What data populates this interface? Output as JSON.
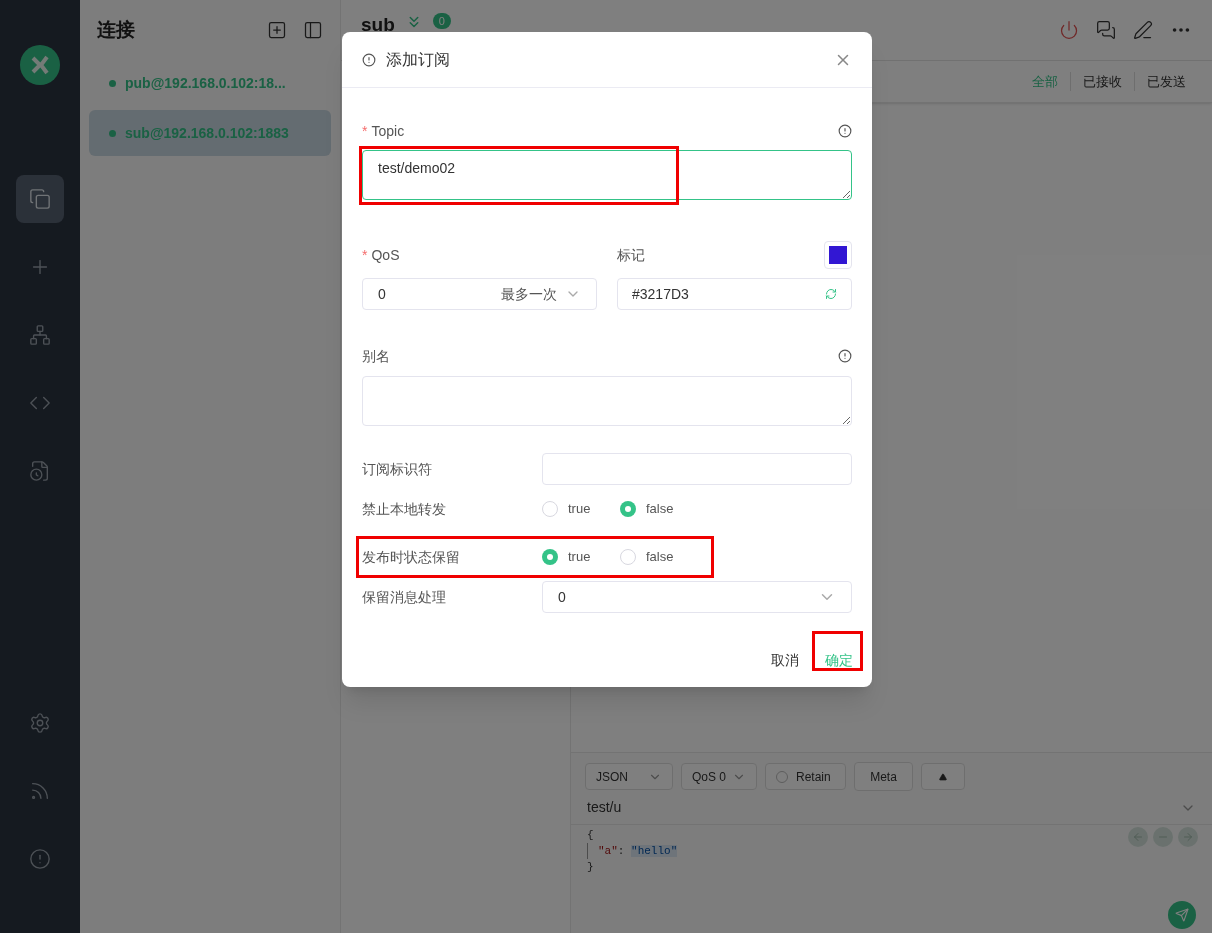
{
  "nav_items": [
    {
      "kind": "connections",
      "selected": true
    },
    {
      "kind": "new",
      "selected": false
    },
    {
      "kind": "network",
      "selected": false
    },
    {
      "kind": "script",
      "selected": false
    },
    {
      "kind": "log",
      "selected": false
    }
  ],
  "nav_bottom": [
    {
      "kind": "settings"
    },
    {
      "kind": "feed"
    },
    {
      "kind": "about"
    }
  ],
  "connections": {
    "title": "连接",
    "items": [
      {
        "name": "pub@192.168.0.102:18...",
        "selected": false
      },
      {
        "name": "sub@192.168.0.102:1883",
        "selected": true
      }
    ]
  },
  "header": {
    "title": "sub",
    "badge": "0"
  },
  "filters": [
    {
      "label": "全部",
      "selected": true
    },
    {
      "label": "已接收",
      "selected": false
    },
    {
      "label": "已发送",
      "selected": false
    }
  ],
  "composer": {
    "format": "JSON",
    "qos": "QoS 0",
    "retain": {
      "label": "Retain",
      "checked": false
    },
    "meta": "Meta",
    "topic": "test/u",
    "payload": [
      {
        "kind": "punct",
        "text": "{"
      },
      {
        "kind": "pair",
        "key": "\"a\"",
        "sep": ":",
        "value": "\"hello\""
      },
      {
        "kind": "punct",
        "text": "}"
      }
    ]
  },
  "dialog": {
    "title": "添加订阅",
    "topic": {
      "label": "Topic",
      "required_mark": "*",
      "value": "test/demo02",
      "highlighted": true
    },
    "qos": {
      "label": "QoS",
      "required_mark": "*",
      "value": "0",
      "hint": "最多一次"
    },
    "mark": {
      "label": "标记",
      "value": "#3217D3",
      "color": "#3217d3"
    },
    "alias": {
      "label": "别名"
    },
    "sub_id": {
      "label": "订阅标识符"
    },
    "radios": [
      {
        "label": "禁止本地转发",
        "highlighted": false,
        "options": [
          {
            "label": "true",
            "selected": false
          },
          {
            "label": "false",
            "selected": true
          }
        ]
      },
      {
        "label": "发布时状态保留",
        "highlighted": true,
        "options": [
          {
            "label": "true",
            "selected": true
          },
          {
            "label": "false",
            "selected": false
          }
        ]
      }
    ],
    "retain_handling": {
      "label": "保留消息处理",
      "value": "0"
    },
    "cancel": "取消",
    "ok": {
      "label": "确定",
      "highlighted": true
    }
  }
}
